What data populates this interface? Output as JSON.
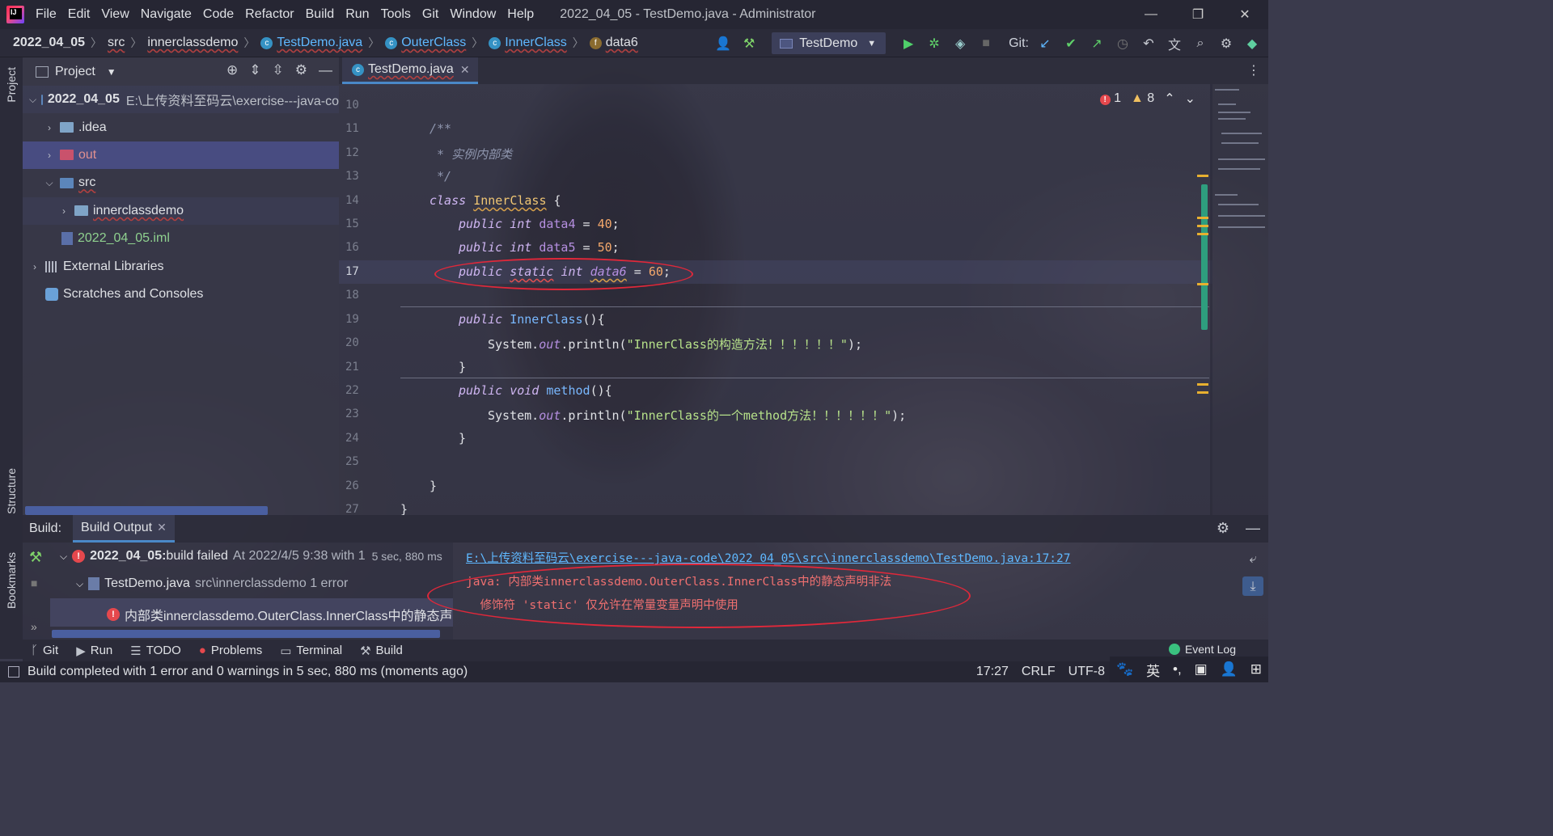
{
  "window": {
    "title": "2022_04_05 - TestDemo.java - Administrator",
    "menu": [
      "File",
      "Edit",
      "View",
      "Navigate",
      "Code",
      "Refactor",
      "Build",
      "Run",
      "Tools",
      "Git",
      "Window",
      "Help"
    ],
    "controls": {
      "minimize": "—",
      "restore": "❐",
      "close": "✕"
    }
  },
  "breadcrumb": {
    "items": [
      "2022_04_05",
      "src",
      "innerclassdemo",
      "TestDemo.java",
      "OuterClass",
      "InnerClass",
      "data6"
    ]
  },
  "toolbar": {
    "run_config": "TestDemo",
    "git_label": "Git:"
  },
  "left_stripe": {
    "project": "Project",
    "structure": "Structure",
    "bookmarks": "Bookmarks"
  },
  "project": {
    "header": "Project",
    "tree": [
      {
        "label": "2022_04_05",
        "path": "E:\\上传资料至码云\\exercise---java-co"
      },
      {
        "label": ".idea"
      },
      {
        "label": "out"
      },
      {
        "label": "src"
      },
      {
        "label": "innerclassdemo"
      },
      {
        "label": "2022_04_05.iml"
      },
      {
        "label": "External Libraries"
      },
      {
        "label": "Scratches and Consoles"
      }
    ]
  },
  "editor": {
    "tab": "TestDemo.java",
    "inspections": {
      "errors": "1",
      "warnings": "8"
    },
    "line_numbers": [
      "10",
      "11",
      "12",
      "13",
      "14",
      "15",
      "16",
      "17",
      "18",
      "19",
      "20",
      "21",
      "22",
      "23",
      "24",
      "25",
      "26",
      "27"
    ],
    "code": {
      "l11": "/**",
      "l12": " * 实例内部类",
      "l13": " */",
      "l14_kw": "class ",
      "l14_cls": "InnerClass",
      "l14_rest": " {",
      "kw_public": "public",
      "kw_int": "int",
      "kw_static": "static",
      "kw_void": "void",
      "data4": "data4",
      "data5": "data5",
      "data6": "data6",
      "v40": "40",
      "v50": "50",
      "v60": "60",
      "ctor": "InnerClass",
      "println1": "\"InnerClass的构造方法！！！！！！\"",
      "method": "method",
      "println2": "\"InnerClass的一个method方法！！！！！！\"",
      "system": "System.",
      "out": "out",
      "println": ".println("
    }
  },
  "build": {
    "label": "Build:",
    "tab": "Build Output",
    "summary_name": "2022_04_05:",
    "summary_text": " build failed",
    "summary_time": "At 2022/4/5 9:38 with 1",
    "summary_dur": "5 sec, 880 ms",
    "file_name": "TestDemo.java",
    "file_path": "src\\innerclassdemo 1 error",
    "error_item": "内部类innerclassdemo.OuterClass.InnerClass中的静态声明非",
    "output_link": "E:\\上传资料至码云\\exercise---java-code\\2022_04_05\\src\\innerclassdemo\\TestDemo.java:17:27",
    "output_line1": "java: 内部类innerclassdemo.OuterClass.InnerClass中的静态声明非法",
    "output_line2": "  修饰符 'static' 仅允许在常量变量声明中使用"
  },
  "bottom_tools": [
    "Git",
    "Run",
    "TODO",
    "Problems",
    "Terminal",
    "Build"
  ],
  "event_log": "Event Log",
  "status": {
    "message": "Build completed with 1 error and 0 warnings in 5 sec, 880 ms (moments ago)",
    "position": "17:27",
    "line_sep": "CRLF",
    "encoding": "UTF-8"
  },
  "tray": {
    "ime": "英"
  },
  "colors": {
    "accent": "#4a88c7",
    "error": "#e5484d",
    "annotation": "#e0283a"
  }
}
